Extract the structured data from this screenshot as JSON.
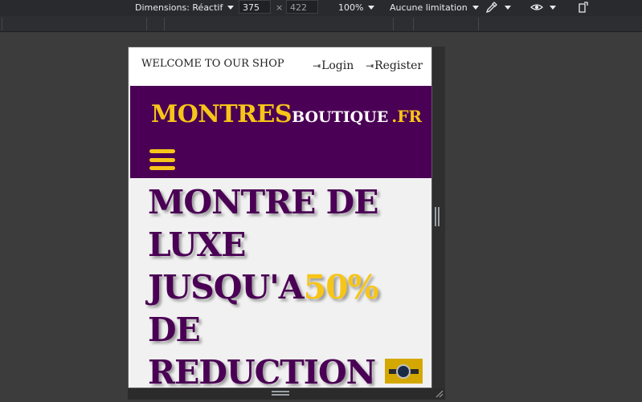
{
  "devtools": {
    "dimensions_label": "Dimensions: Réactif",
    "width_value": "375",
    "times": "×",
    "height_value": "422",
    "zoom": "100%",
    "throttle": "Aucune limitation"
  },
  "shop": {
    "welcome": "WELCOME TO OUR SHOP",
    "login_label": "Login",
    "register_label": "Register",
    "login_icon": "sign-in-icon",
    "register_icon": "sign-in-icon",
    "logo_main": "MONTRES",
    "logo_sub": "BOUTIQUE",
    "logo_tld": ".FR",
    "hero_line1": "MONTRE DE",
    "hero_line2": "LUXE",
    "hero_line3": "JUSQU'A",
    "hero_highlight": "50%",
    "hero_line4": "DE",
    "hero_line5": "REDUCTION",
    "colors": {
      "brand_purple": "#4a0054",
      "brand_yellow": "#f7c518",
      "hero_bg": "#f1f1f1"
    }
  }
}
